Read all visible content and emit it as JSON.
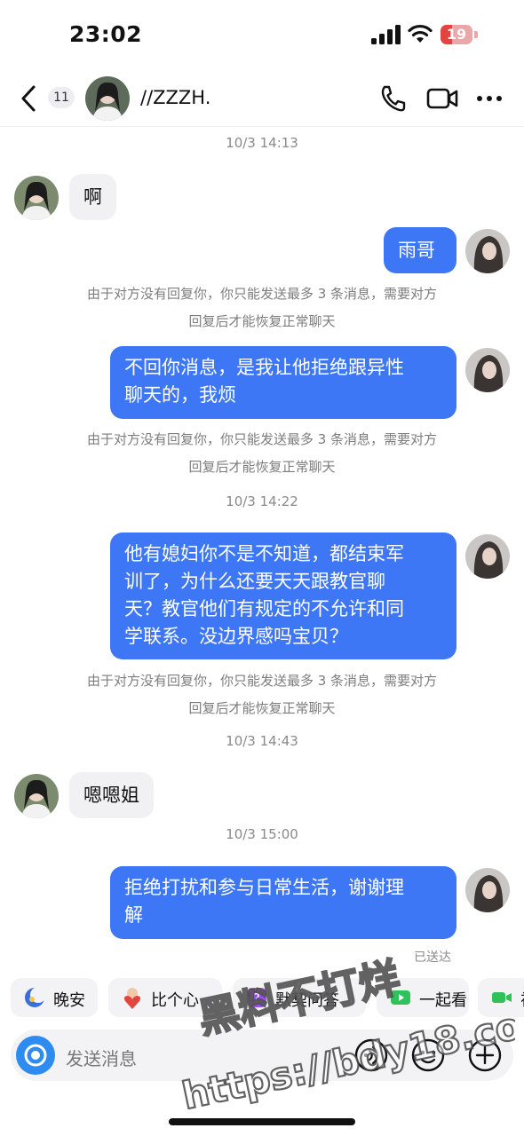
{
  "status_bar": {
    "time": "23:02",
    "battery": "19"
  },
  "header": {
    "unread_count": "11",
    "contact_name": "//ZZZH."
  },
  "messages": {
    "ts1": "10/3 14:13",
    "m1": "啊",
    "m2": "雨哥",
    "notice_l1": "由于对方没有回复你，你只能发送最多 3 条消息，需要对方",
    "notice_l2": "回复后才能恢复正常聊天",
    "m3_l1": "不回你消息，是我让他拒绝跟异性",
    "m3_l2": "聊天的，我烦",
    "ts2": "10/3 14:22",
    "m4_l1": "他有媳妇你不是不知道，都结束军",
    "m4_l2": "训了，为什么还要天天跟教官聊",
    "m4_l3": "天？教官他们有规定的不允许和同",
    "m4_l4": "学联系。没边界感吗宝贝？",
    "ts3": "10/3 14:43",
    "m5": "嗯嗯姐",
    "ts4": "10/3 15:00",
    "m6_l1": "拒绝打扰和参与日常生活，谢谢理",
    "m6_l2": "解",
    "sent_status": "已送达"
  },
  "quick_replies": [
    "晚安",
    "比个心",
    "默契问答",
    "一起看",
    "视"
  ],
  "composer": {
    "placeholder": "发送消息"
  },
  "watermark": {
    "line1": "黑料不打烊",
    "line2": "https://bdy18.co"
  },
  "colors": {
    "outgoing_bubble": "#3e77f5",
    "incoming_bubble": "#f1f1f3",
    "accent_camera": "#2e8bf0"
  }
}
